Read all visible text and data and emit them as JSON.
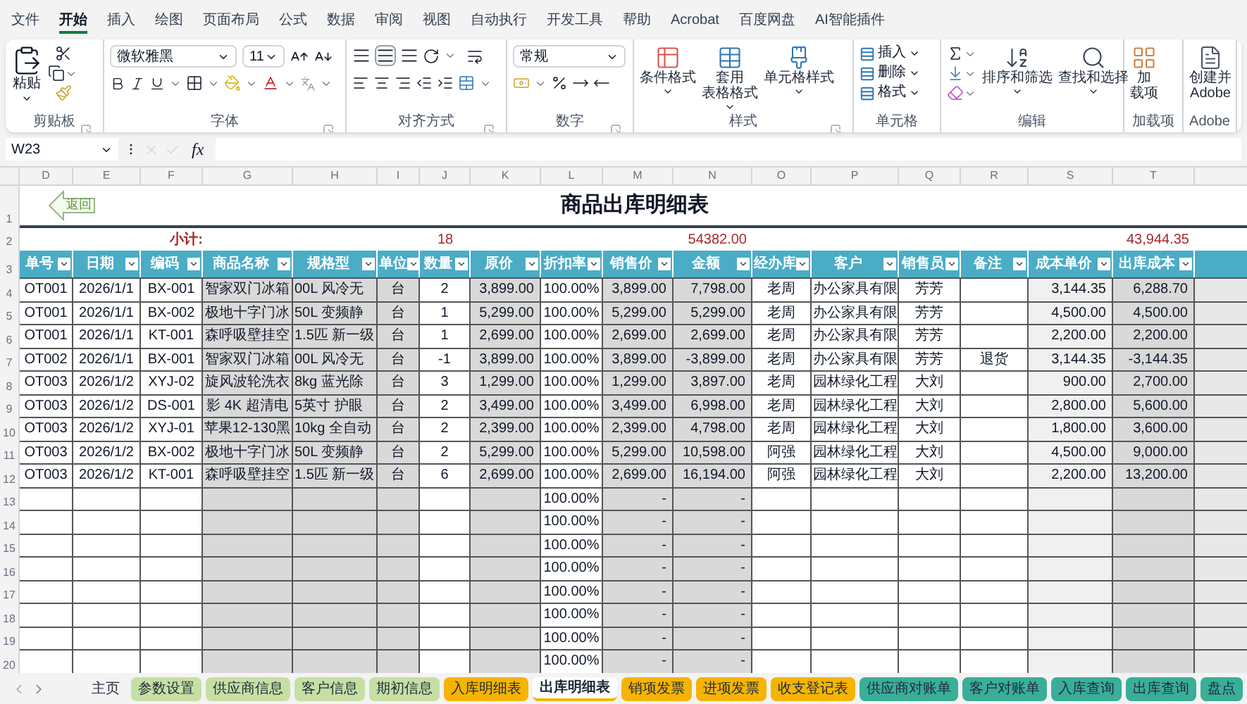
{
  "menu_tabs": [
    {
      "label": "文件",
      "selected": false
    },
    {
      "label": "开始",
      "selected": true
    },
    {
      "label": "插入",
      "selected": false
    },
    {
      "label": "绘图",
      "selected": false
    },
    {
      "label": "页面布局",
      "selected": false
    },
    {
      "label": "公式",
      "selected": false
    },
    {
      "label": "数据",
      "selected": false
    },
    {
      "label": "审阅",
      "selected": false
    },
    {
      "label": "视图",
      "selected": false
    },
    {
      "label": "自动执行",
      "selected": false
    },
    {
      "label": "开发工具",
      "selected": false
    },
    {
      "label": "帮助",
      "selected": false
    },
    {
      "label": "Acrobat",
      "selected": false
    },
    {
      "label": "百度网盘",
      "selected": false
    },
    {
      "label": "AI智能插件",
      "selected": false
    }
  ],
  "ribbon": {
    "clipboard": {
      "label": "剪贴板",
      "paste": "粘贴"
    },
    "font": {
      "label": "字体",
      "family": "微软雅黑",
      "size": "11"
    },
    "alignment": {
      "label": "对齐方式"
    },
    "number": {
      "label": "数字",
      "format": "常规"
    },
    "styles": {
      "label": "样式",
      "buttons": [
        {
          "lines": [
            "条件格式"
          ]
        },
        {
          "lines": [
            "套用",
            "表格格式"
          ]
        },
        {
          "lines": [
            "单元格样式"
          ]
        }
      ]
    },
    "cells": {
      "label": "单元格",
      "buttons": [
        "插入",
        "删除",
        "格式"
      ]
    },
    "editing": {
      "label": "编辑",
      "buttons": [
        "排序和筛选",
        "查找和选择"
      ]
    },
    "addins": {
      "label": "加载项",
      "lines": [
        "加",
        "载项"
      ]
    },
    "adobe": {
      "label": "Adobe",
      "lines": [
        "创建并",
        "Adobe"
      ]
    }
  },
  "formula_bar": {
    "cell_ref": "W23",
    "function_label": "fx"
  },
  "sheet": {
    "column_letters": [
      "D",
      "E",
      "F",
      "G",
      "H",
      "I",
      "J",
      "K",
      "L",
      "M",
      "N",
      "O",
      "P",
      "Q",
      "R",
      "S",
      "T"
    ],
    "row_numbers": [
      "1",
      "2",
      "3",
      "4",
      "5",
      "6",
      "7",
      "8",
      "9",
      "10",
      "11",
      "12",
      "13",
      "14",
      "15",
      "16",
      "17",
      "18",
      "19",
      "20"
    ],
    "back_button": "返回",
    "title": "商品出库明细表",
    "subtotal": {
      "label": "小计:",
      "quantity": "18",
      "amount": "54382.00",
      "cost": "43,944.35"
    },
    "headers": [
      "单号",
      "日期",
      "编码",
      "商品名称",
      "规格型",
      "单位",
      "数量",
      "原价",
      "折扣率",
      "销售价",
      "金额",
      "经办库",
      "客户",
      "销售员",
      "备注",
      "成本单价",
      "出库成本"
    ],
    "rows": [
      {
        "no": "OT001",
        "date": "2026/1/1",
        "code": "BX-001",
        "name": "智家双门冰箱",
        "spec": "00L 风冷无",
        "unit": "台",
        "qty": "2",
        "price": "3,899.00",
        "discount": "100.00%",
        "sale_price": "3,899.00",
        "amount": "7,798.00",
        "handler": "老周",
        "customer": "办公家具有限",
        "salesman": "芳芳",
        "unit_cost": "3,144.35",
        "cost": "6,288.70"
      },
      {
        "no": "OT001",
        "date": "2026/1/1",
        "code": "BX-002",
        "name": "极地十字门冰",
        "spec": "50L 变频静",
        "unit": "台",
        "qty": "1",
        "price": "5,299.00",
        "discount": "100.00%",
        "sale_price": "5,299.00",
        "amount": "5,299.00",
        "handler": "老周",
        "customer": "办公家具有限",
        "salesman": "芳芳",
        "unit_cost": "4,500.00",
        "cost": "4,500.00"
      },
      {
        "no": "OT001",
        "date": "2026/1/1",
        "code": "KT-001",
        "name": "森呼吸壁挂空",
        "spec": "1.5匹 新一级",
        "unit": "台",
        "qty": "1",
        "price": "2,699.00",
        "discount": "100.00%",
        "sale_price": "2,699.00",
        "amount": "2,699.00",
        "handler": "老周",
        "customer": "办公家具有限",
        "salesman": "芳芳",
        "unit_cost": "2,200.00",
        "cost": "2,200.00"
      },
      {
        "no": "OT002",
        "date": "2026/1/1",
        "code": "BX-001",
        "name": "智家双门冰箱",
        "spec": "00L 风冷无",
        "unit": "台",
        "qty": "-1",
        "price": "3,899.00",
        "discount": "100.00%",
        "sale_price": "3,899.00",
        "amount": "-3,899.00",
        "handler": "老周",
        "customer": "办公家具有限",
        "salesman": "芳芳",
        "note": "退货",
        "unit_cost": "3,144.35",
        "cost": "-3,144.35"
      },
      {
        "no": "OT003",
        "date": "2026/1/2",
        "code": "XYJ-02",
        "name": "旋风波轮洗衣",
        "spec": "8kg 蓝光除",
        "unit": "台",
        "qty": "3",
        "price": "1,299.00",
        "discount": "100.00%",
        "sale_price": "1,299.00",
        "amount": "3,897.00",
        "handler": "老周",
        "customer": "园林绿化工程",
        "salesman": "大刘",
        "unit_cost": "900.00",
        "cost": "2,700.00"
      },
      {
        "no": "OT003",
        "date": "2026/1/2",
        "code": "DS-001",
        "name": "影 4K 超清电",
        "spec": "5英寸 护眼",
        "unit": "台",
        "qty": "2",
        "price": "3,499.00",
        "discount": "100.00%",
        "sale_price": "3,499.00",
        "amount": "6,998.00",
        "handler": "老周",
        "customer": "园林绿化工程",
        "salesman": "大刘",
        "unit_cost": "2,800.00",
        "cost": "5,600.00"
      },
      {
        "no": "OT003",
        "date": "2026/1/2",
        "code": "XYJ-01",
        "name": "苹果12-130黑",
        "spec": "10kg 全自动",
        "unit": "台",
        "qty": "2",
        "price": "2,399.00",
        "discount": "100.00%",
        "sale_price": "2,399.00",
        "amount": "4,798.00",
        "handler": "老周",
        "customer": "园林绿化工程",
        "salesman": "大刘",
        "unit_cost": "1,800.00",
        "cost": "3,600.00"
      },
      {
        "no": "OT003",
        "date": "2026/1/2",
        "code": "BX-002",
        "name": "极地十字门冰",
        "spec": "50L 变频静",
        "unit": "台",
        "qty": "2",
        "price": "5,299.00",
        "discount": "100.00%",
        "sale_price": "5,299.00",
        "amount": "10,598.00",
        "handler": "阿强",
        "customer": "园林绿化工程",
        "salesman": "大刘",
        "unit_cost": "4,500.00",
        "cost": "9,000.00"
      },
      {
        "no": "OT003",
        "date": "2026/1/2",
        "code": "KT-001",
        "name": "森呼吸壁挂空",
        "spec": "1.5匹 新一级",
        "unit": "台",
        "qty": "6",
        "price": "2,699.00",
        "discount": "100.00%",
        "sale_price": "2,699.00",
        "amount": "16,194.00",
        "handler": "阿强",
        "customer": "园林绿化工程",
        "salesman": "大刘",
        "unit_cost": "2,200.00",
        "cost": "13,200.00"
      },
      {
        "discount": "100.00%",
        "sale_price": "-",
        "amount": "-"
      },
      {
        "discount": "100.00%",
        "sale_price": "-",
        "amount": "-"
      },
      {
        "discount": "100.00%",
        "sale_price": "-",
        "amount": "-"
      },
      {
        "discount": "100.00%",
        "sale_price": "-",
        "amount": "-"
      },
      {
        "discount": "100.00%",
        "sale_price": "-",
        "amount": "-"
      },
      {
        "discount": "100.00%",
        "sale_price": "-",
        "amount": "-"
      },
      {
        "discount": "100.00%",
        "sale_price": "-",
        "amount": "-"
      },
      {
        "discount": "100.00%",
        "sale_price": "-",
        "amount": "-"
      }
    ]
  },
  "sheet_tabs": [
    {
      "label": "主页",
      "selected": false
    },
    {
      "label": "参数设置",
      "selected": false,
      "color": "#c6e0a4"
    },
    {
      "label": "供应商信息",
      "selected": false,
      "color": "#c6e0a4"
    },
    {
      "label": "客户信息",
      "selected": false,
      "color": "#c6e0a4"
    },
    {
      "label": "期初信息",
      "selected": false,
      "color": "#c6e0a4"
    },
    {
      "label": "入库明细表",
      "selected": false,
      "color": "#f5b400"
    },
    {
      "label": "出库明细表",
      "selected": true,
      "color": "#f5b400"
    },
    {
      "label": "销项发票",
      "selected": false,
      "color": "#f5b400"
    },
    {
      "label": "进项发票",
      "selected": false,
      "color": "#f5b400"
    },
    {
      "label": "收支登记表",
      "selected": false,
      "color": "#f5b400"
    },
    {
      "label": "供应商对账单",
      "selected": false,
      "color": "#3aae98"
    },
    {
      "label": "客户对账单",
      "selected": false,
      "color": "#3aae98"
    },
    {
      "label": "入库查询",
      "selected": false,
      "color": "#3aae98"
    },
    {
      "label": "出库查询",
      "selected": false,
      "color": "#3aae98"
    },
    {
      "label": "盘点",
      "selected": false,
      "color": "#3aae98"
    }
  ]
}
